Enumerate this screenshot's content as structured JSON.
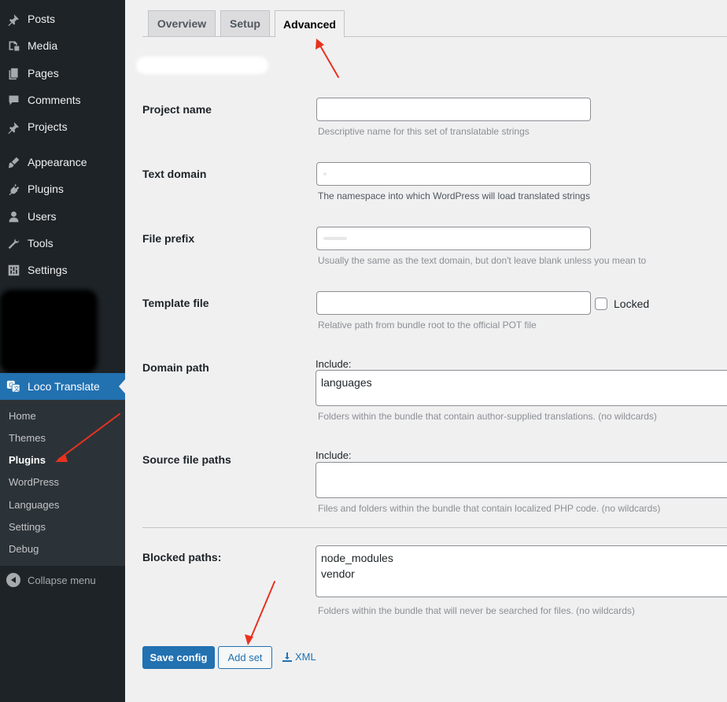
{
  "sidebar": {
    "items": [
      {
        "label": "Posts",
        "icon": "pin-icon"
      },
      {
        "label": "Media",
        "icon": "media-icon"
      },
      {
        "label": "Pages",
        "icon": "pages-icon"
      },
      {
        "label": "Comments",
        "icon": "comment-icon"
      },
      {
        "label": "Projects",
        "icon": "pin-icon"
      },
      {
        "label": "Appearance",
        "icon": "brush-icon"
      },
      {
        "label": "Plugins",
        "icon": "plugin-icon"
      },
      {
        "label": "Users",
        "icon": "user-icon"
      },
      {
        "label": "Tools",
        "icon": "wrench-icon"
      },
      {
        "label": "Settings",
        "icon": "settings-icon"
      }
    ],
    "active": {
      "label": "Loco Translate",
      "icon": "translate-icon"
    },
    "submenu": [
      "Home",
      "Themes",
      "Plugins",
      "WordPress",
      "Languages",
      "Settings",
      "Debug"
    ],
    "submenu_current": "Plugins",
    "collapse": "Collapse menu"
  },
  "tabs": [
    "Overview",
    "Setup",
    "Advanced"
  ],
  "active_tab": "Advanced",
  "form": {
    "project_name": {
      "label": "Project name",
      "value": "",
      "description": "Descriptive name for this set of translatable strings"
    },
    "text_domain": {
      "label": "Text domain",
      "value": "",
      "description": "The namespace into which WordPress will load translated strings"
    },
    "file_prefix": {
      "label": "File prefix",
      "value": "",
      "description": "Usually the same as the text domain, but don't leave blank unless you mean to"
    },
    "template_file": {
      "label": "Template file",
      "value": "",
      "locked_label": "Locked",
      "locked": false,
      "description": "Relative path from bundle root to the official POT file"
    },
    "domain_path": {
      "label": "Domain path",
      "include_label": "Include:",
      "value": "languages",
      "description": "Folders within the bundle that contain author-supplied translations. (no wildcards)"
    },
    "source_paths": {
      "label": "Source file paths",
      "include_label": "Include:",
      "value": "",
      "description": "Files and folders within the bundle that contain localized PHP code. (no wildcards)"
    },
    "blocked_paths": {
      "label": "Blocked paths:",
      "value": "node_modules\nvendor",
      "description": "Folders within the bundle that will never be searched for files. (no wildcards)"
    }
  },
  "buttons": {
    "save": "Save config",
    "add_set": "Add set",
    "xml": "XML"
  },
  "colors": {
    "accent": "#2271b1",
    "sidebar_bg": "#1d2327",
    "annotation": "#e8321f"
  }
}
